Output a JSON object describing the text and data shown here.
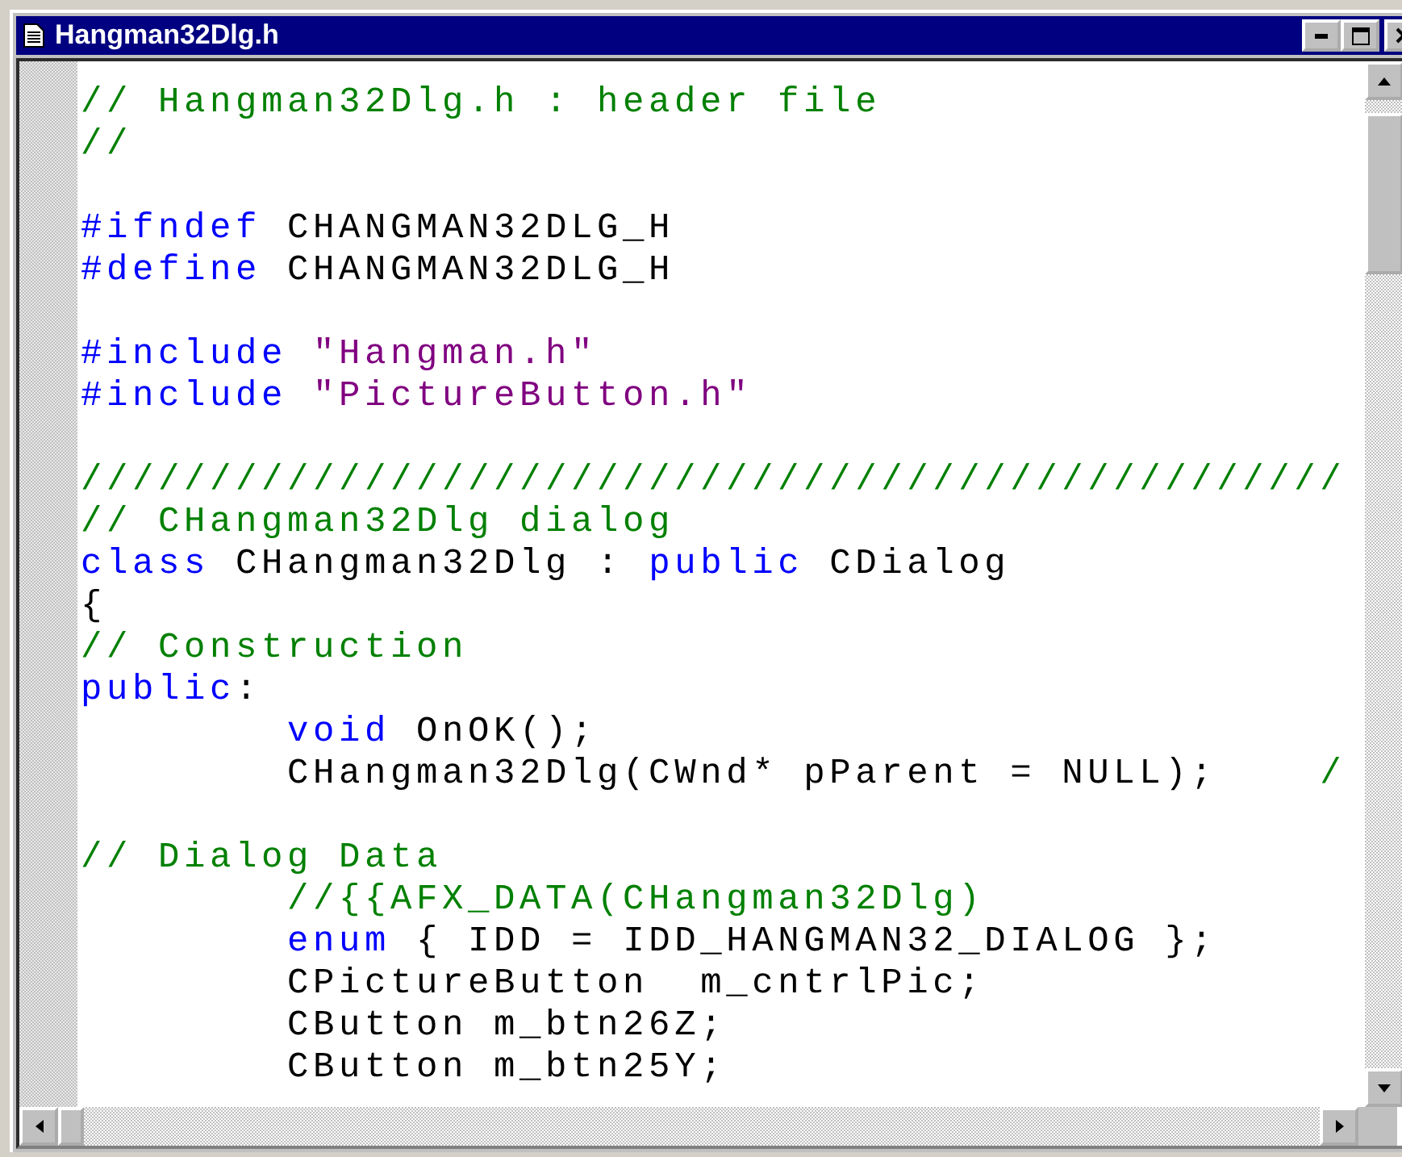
{
  "window": {
    "title": "Hangman32Dlg.h"
  },
  "editor": {
    "lines": [
      {
        "kind": "code",
        "tokens": [
          {
            "kind": "comment",
            "text": "// Hangman32Dlg.h : header file"
          }
        ]
      },
      {
        "kind": "code",
        "tokens": [
          {
            "kind": "comment",
            "text": "//"
          }
        ]
      },
      {
        "kind": "blank"
      },
      {
        "kind": "code",
        "tokens": [
          {
            "kind": "keyword",
            "text": "#ifndef"
          },
          {
            "kind": "plain",
            "text": " CHANGMAN32DLG_H"
          }
        ]
      },
      {
        "kind": "code",
        "tokens": [
          {
            "kind": "keyword",
            "text": "#define"
          },
          {
            "kind": "plain",
            "text": " CHANGMAN32DLG_H"
          }
        ]
      },
      {
        "kind": "blank"
      },
      {
        "kind": "code",
        "tokens": [
          {
            "kind": "keyword",
            "text": "#include"
          },
          {
            "kind": "string",
            "text": " \"Hangman.h\""
          }
        ]
      },
      {
        "kind": "code",
        "tokens": [
          {
            "kind": "keyword",
            "text": "#include"
          },
          {
            "kind": "string",
            "text": " \"PictureButton.h\""
          }
        ]
      },
      {
        "kind": "blank"
      },
      {
        "kind": "code",
        "tokens": [
          {
            "kind": "comment",
            "text": "/////////////////////////////////////////////////"
          }
        ]
      },
      {
        "kind": "code",
        "tokens": [
          {
            "kind": "comment",
            "text": "// CHangman32Dlg dialog"
          }
        ]
      },
      {
        "kind": "code",
        "tokens": [
          {
            "kind": "keyword",
            "text": "class"
          },
          {
            "kind": "plain",
            "text": " CHangman32Dlg : "
          },
          {
            "kind": "keyword",
            "text": "public"
          },
          {
            "kind": "plain",
            "text": " CDialog"
          }
        ]
      },
      {
        "kind": "code",
        "tokens": [
          {
            "kind": "plain",
            "text": "{"
          }
        ]
      },
      {
        "kind": "code",
        "tokens": [
          {
            "kind": "comment",
            "text": "// Construction"
          }
        ]
      },
      {
        "kind": "code",
        "tokens": [
          {
            "kind": "keyword",
            "text": "public"
          },
          {
            "kind": "plain",
            "text": ":"
          }
        ]
      },
      {
        "kind": "code",
        "tokens": [
          {
            "kind": "keyword",
            "text": "\tvoid"
          },
          {
            "kind": "plain",
            "text": " OnOK();"
          }
        ]
      },
      {
        "kind": "code",
        "tokens": [
          {
            "kind": "plain",
            "text": "\tCHangman32Dlg(CWnd* pParent = NULL);\t"
          },
          {
            "kind": "comment",
            "text": "/"
          }
        ]
      },
      {
        "kind": "blank"
      },
      {
        "kind": "code",
        "tokens": [
          {
            "kind": "comment",
            "text": "// Dialog Data"
          }
        ]
      },
      {
        "kind": "code",
        "tokens": [
          {
            "kind": "comment",
            "text": "\t//{{AFX_DATA(CHangman32Dlg)"
          }
        ]
      },
      {
        "kind": "code",
        "tokens": [
          {
            "kind": "keyword",
            "text": "\tenum"
          },
          {
            "kind": "plain",
            "text": " { IDD = IDD_HANGMAN32_DIALOG };"
          }
        ]
      },
      {
        "kind": "code",
        "tokens": [
          {
            "kind": "plain",
            "text": "\tCPictureButton\tm_cntrlPic;"
          }
        ]
      },
      {
        "kind": "code",
        "tokens": [
          {
            "kind": "plain",
            "text": "\tCButton m_btn26Z;"
          }
        ]
      },
      {
        "kind": "code",
        "tokens": [
          {
            "kind": "plain",
            "text": "\tCButton m_btn25Y;"
          }
        ]
      }
    ]
  }
}
